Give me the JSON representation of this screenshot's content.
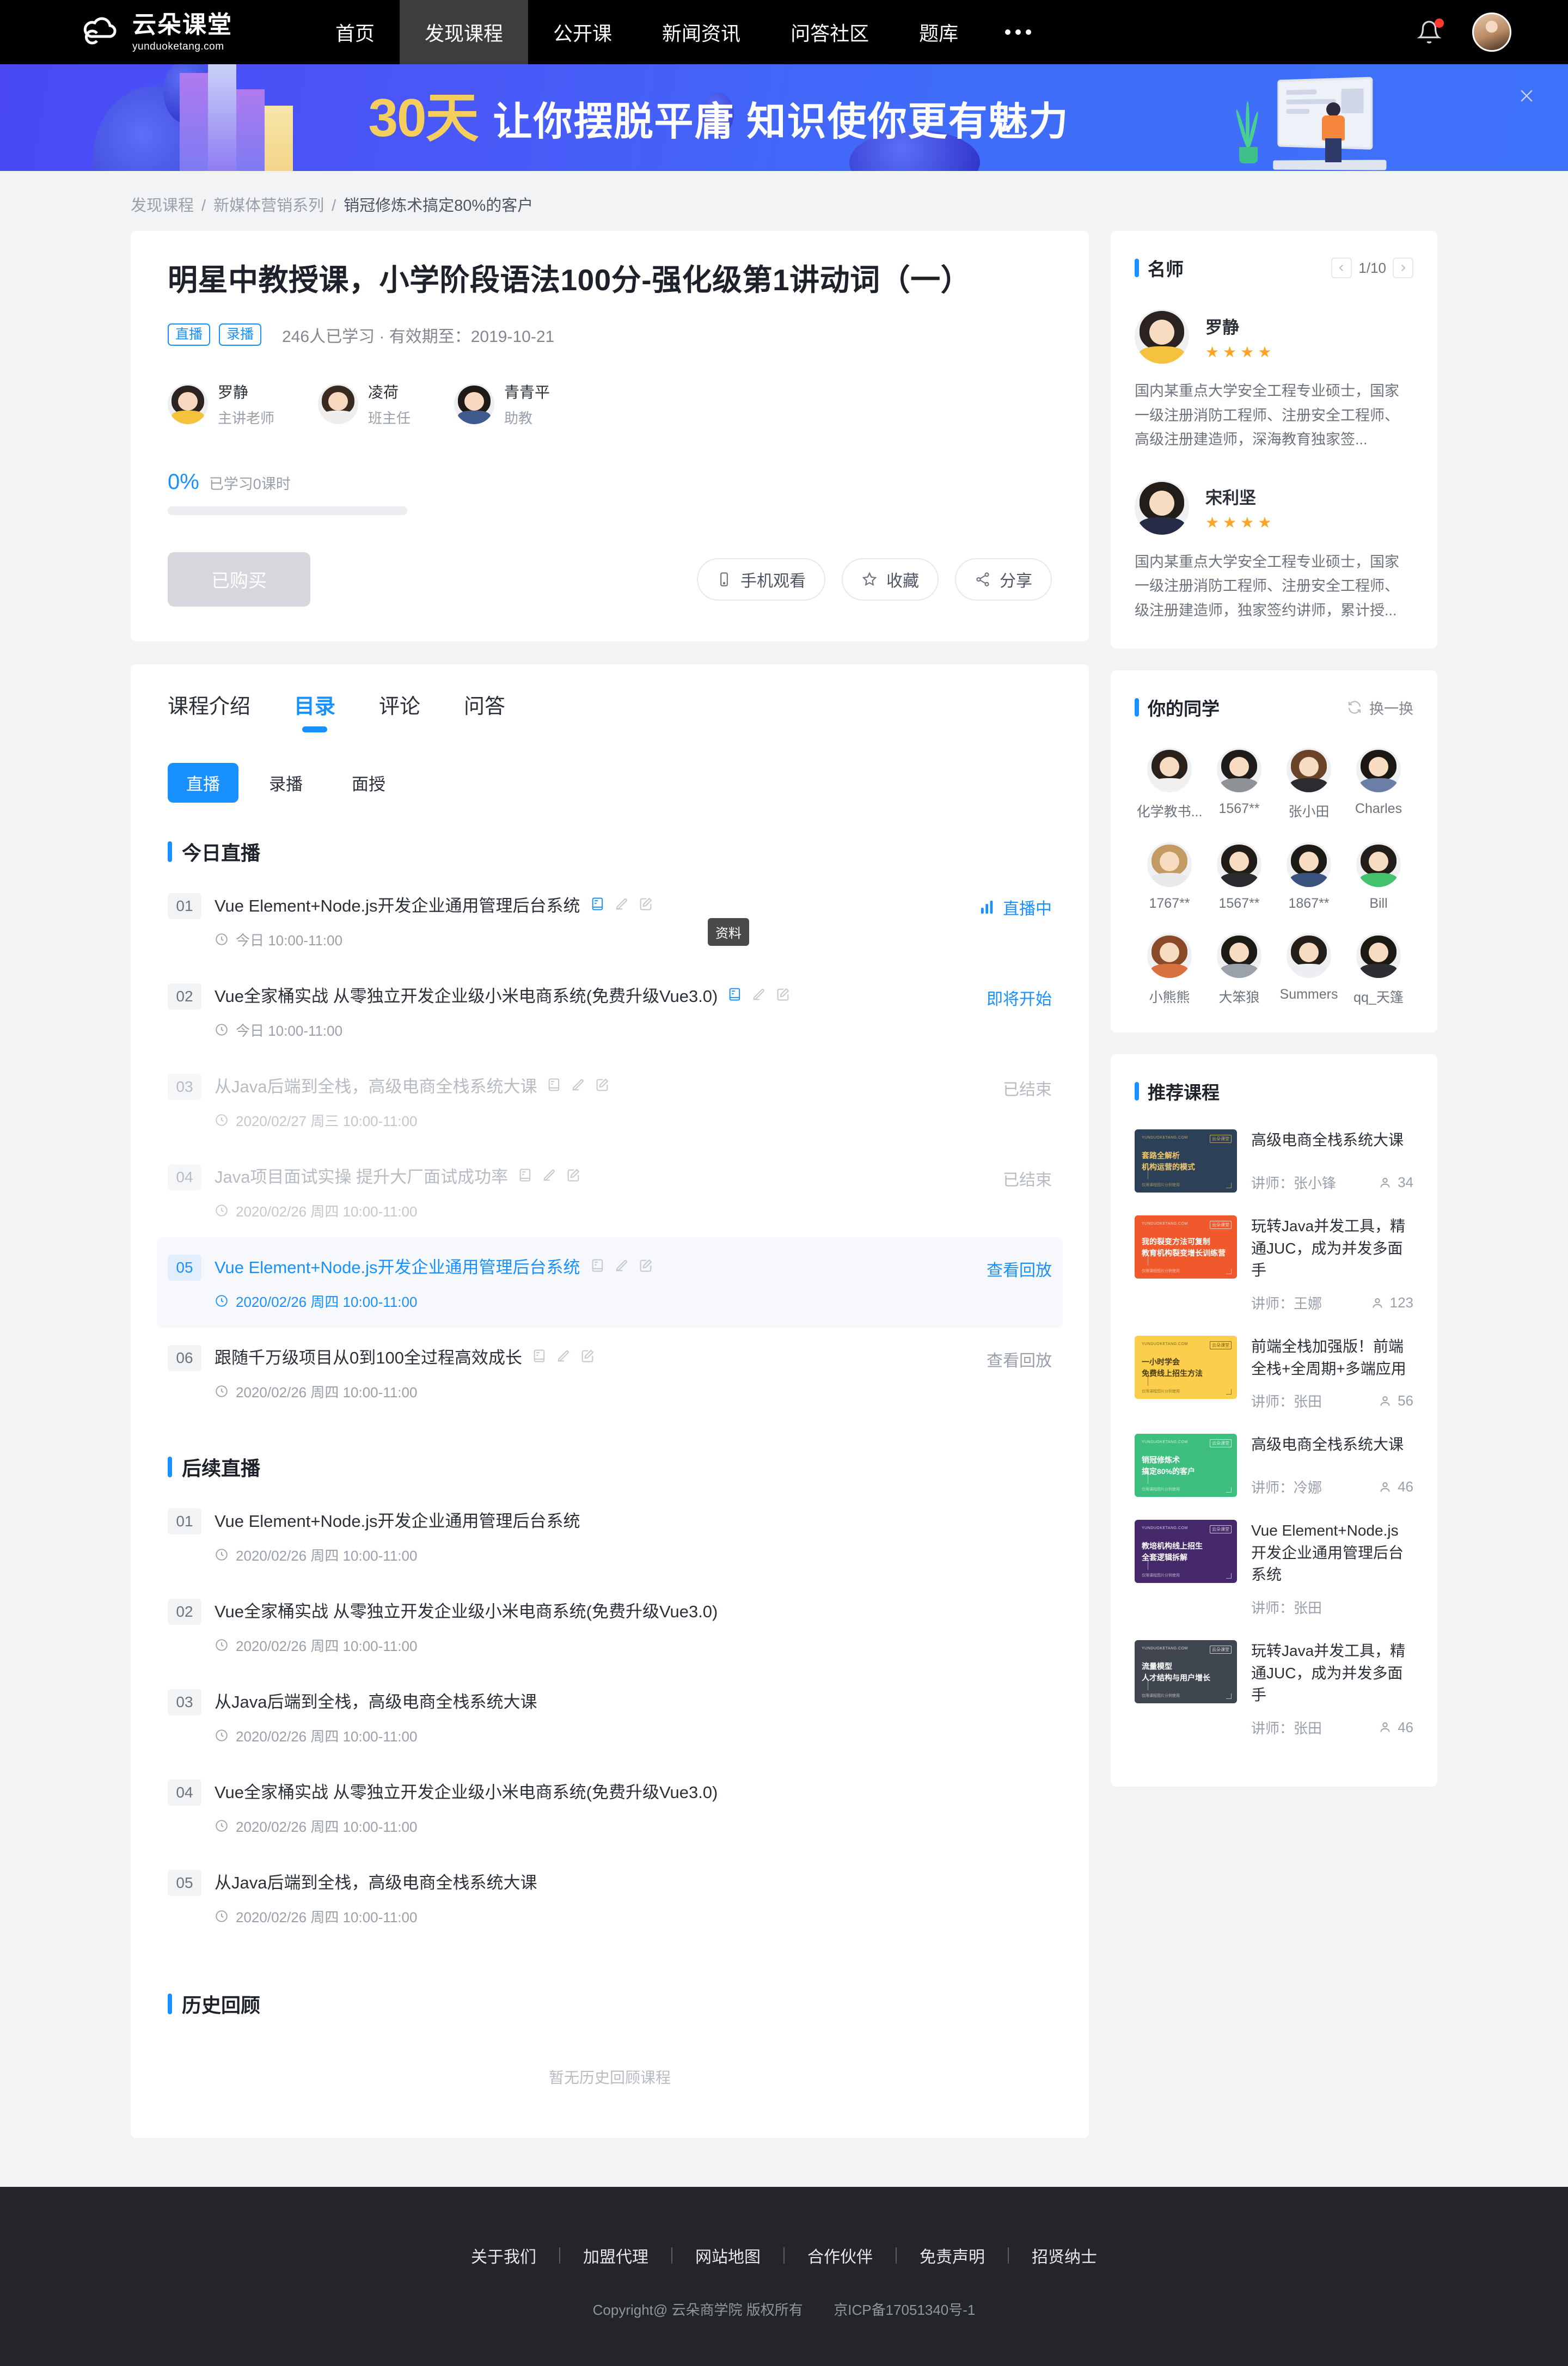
{
  "nav": {
    "logo_cn": "云朵课堂",
    "logo_en": "yunduoketang.com",
    "items": [
      {
        "label": "首页",
        "active": false
      },
      {
        "label": "发现课程",
        "active": true
      },
      {
        "label": "公开课",
        "active": false
      },
      {
        "label": "新闻资讯",
        "active": false
      },
      {
        "label": "问答社区",
        "active": false
      },
      {
        "label": "题库",
        "active": false
      }
    ],
    "more_icon": "more-dots-icon",
    "bell_icon": "bell-icon",
    "avatar_icon": "user-avatar"
  },
  "banner": {
    "highlight": "30天",
    "text": "让你摆脱平庸  知识使你更有魅力",
    "close_icon": "close-icon"
  },
  "breadcrumb": {
    "items": [
      "发现课程",
      "新媒体营销系列"
    ],
    "current": "销冠修炼术搞定80%的客户",
    "separator": "/"
  },
  "course": {
    "title": "明星中教授课，小学阶段语法100分-强化级第1讲动词（一）",
    "badges": [
      "直播",
      "录播"
    ],
    "meta": "246人已学习 · 有效期至：2019-10-21",
    "teachers": [
      {
        "name": "罗静",
        "role": "主讲老师"
      },
      {
        "name": "凌荷",
        "role": "班主任"
      },
      {
        "name": "青青平",
        "role": "助教"
      }
    ],
    "progress_percent": "0%",
    "progress_label": "已学习0课时",
    "progress_value": 0,
    "buy_button": "已购买",
    "mini_actions": [
      {
        "label": "手机观看",
        "icon": "phone-icon"
      },
      {
        "label": "收藏",
        "icon": "star-icon"
      },
      {
        "label": "分享",
        "icon": "share-icon"
      }
    ]
  },
  "tabs": [
    {
      "label": "课程介绍",
      "active": false
    },
    {
      "label": "目录",
      "active": true
    },
    {
      "label": "评论",
      "active": false
    },
    {
      "label": "问答",
      "active": false
    }
  ],
  "segments": [
    {
      "label": "直播",
      "active": true
    },
    {
      "label": "录播",
      "active": false
    },
    {
      "label": "面授",
      "active": false
    }
  ],
  "tooltip": "资料",
  "sections": [
    {
      "title": "今日直播",
      "lessons": [
        {
          "num": "01",
          "title": "Vue Element+Node.js开发企业通用管理后台系统",
          "time": "今日 10:00-11:00",
          "status": "直播中",
          "status_style": "blue",
          "row_style": "normal",
          "icons": true,
          "status_icon": "live-signal-icon"
        },
        {
          "num": "02",
          "title": "Vue全家桶实战 从零独立开发企业级小米电商系统(免费升级Vue3.0)",
          "time": "今日 10:00-11:00",
          "status": "即将开始",
          "status_style": "blue",
          "row_style": "normal",
          "icons": true,
          "status_icon": ""
        },
        {
          "num": "03",
          "title": "从Java后端到全栈，高级电商全栈系统大课",
          "time": "2020/02/27 周三 10:00-11:00",
          "status": "已结束",
          "status_style": "dim",
          "row_style": "dimmed",
          "icons": true,
          "status_icon": ""
        },
        {
          "num": "04",
          "title": "Java项目面试实操 提升大厂面试成功率",
          "time": "2020/02/26 周四 10:00-11:00",
          "status": "已结束",
          "status_style": "dim",
          "row_style": "dimmed",
          "icons": true,
          "status_icon": ""
        },
        {
          "num": "05",
          "title": "Vue Element+Node.js开发企业通用管理后台系统",
          "time": "2020/02/26 周四 10:00-11:00",
          "status": "查看回放",
          "status_style": "blue",
          "row_style": "highlight",
          "icons": true,
          "status_icon": ""
        },
        {
          "num": "06",
          "title": "跟随千万级项目从0到100全过程高效成长",
          "time": "2020/02/26 周四 10:00-11:00",
          "status": "查看回放",
          "status_style": "normal",
          "row_style": "normal",
          "icons": true,
          "status_icon": ""
        }
      ]
    },
    {
      "title": "后续直播",
      "lessons": [
        {
          "num": "01",
          "title": "Vue Element+Node.js开发企业通用管理后台系统",
          "time": "2020/02/26 周四 10:00-11:00",
          "status": "",
          "status_style": "normal",
          "row_style": "normal",
          "icons": false,
          "status_icon": ""
        },
        {
          "num": "02",
          "title": "Vue全家桶实战 从零独立开发企业级小米电商系统(免费升级Vue3.0)",
          "time": "2020/02/26 周四 10:00-11:00",
          "status": "",
          "status_style": "normal",
          "row_style": "normal",
          "icons": false,
          "status_icon": ""
        },
        {
          "num": "03",
          "title": "从Java后端到全栈，高级电商全栈系统大课",
          "time": "2020/02/26 周四 10:00-11:00",
          "status": "",
          "status_style": "normal",
          "row_style": "normal",
          "icons": false,
          "status_icon": ""
        },
        {
          "num": "04",
          "title": "Vue全家桶实战 从零独立开发企业级小米电商系统(免费升级Vue3.0)",
          "time": "2020/02/26 周四 10:00-11:00",
          "status": "",
          "status_style": "normal",
          "row_style": "normal",
          "icons": false,
          "status_icon": ""
        },
        {
          "num": "05",
          "title": "从Java后端到全栈，高级电商全栈系统大课",
          "time": "2020/02/26 周四 10:00-11:00",
          "status": "",
          "status_style": "normal",
          "row_style": "normal",
          "icons": false,
          "status_icon": ""
        }
      ]
    }
  ],
  "history": {
    "title": "历史回顾",
    "empty": "暂无历史回顾课程"
  },
  "sidebar": {
    "famous_teachers": {
      "title": "名师",
      "page": "1/10",
      "prev_icon": "chevron-left-icon",
      "next_icon": "chevron-right-icon",
      "list": [
        {
          "name": "罗静",
          "stars": 4,
          "desc": "国内某重点大学安全工程专业硕士，国家一级注册消防工程师、注册安全工程师、高级注册建造师，深海教育独家签...",
          "hair": "#2a2320",
          "body": "#f4c23c"
        },
        {
          "name": "宋利坚",
          "stars": 4,
          "desc": "国内某重点大学安全工程专业硕士，国家一级注册消防工程师、注册安全工程师、级注册建造师，独家签约讲师，累计授...",
          "hair": "#231d19",
          "body": "#262c46"
        }
      ]
    },
    "classmates": {
      "title": "你的同学",
      "refresh_label": "换一换",
      "refresh_icon": "refresh-icon",
      "list": [
        {
          "name": "化学教书...",
          "hair": "#2b211c",
          "body": "#f2f0ee"
        },
        {
          "name": "1567**",
          "hair": "#1f1b18",
          "body": "#8e9196"
        },
        {
          "name": "张小田",
          "hair": "#6b4327",
          "body": "#2c2c30"
        },
        {
          "name": "Charles",
          "hair": "#1c1713",
          "body": "#6b7fa6"
        },
        {
          "name": "1767**",
          "hair": "#c49a63",
          "body": "#e8e9eb"
        },
        {
          "name": "1567**",
          "hair": "#211c18",
          "body": "#2a2a2e"
        },
        {
          "name": "1867**",
          "hair": "#1d1915",
          "body": "#39527e"
        },
        {
          "name": "Bill",
          "hair": "#221d18",
          "body": "#43c16b"
        },
        {
          "name": "小熊熊",
          "hair": "#8a4a27",
          "body": "#d9713f"
        },
        {
          "name": "大笨狼",
          "hair": "#1e1a16",
          "body": "#9aa1ab"
        },
        {
          "name": "Summers",
          "hair": "#231e19",
          "body": "#eceef1"
        },
        {
          "name": "qq_天篷",
          "hair": "#1c1814",
          "body": "#2e2e32"
        }
      ]
    },
    "recommended": {
      "title": "推荐课程",
      "teacher_prefix": "讲师：",
      "list": [
        {
          "title": "高级电商全栈系统大课",
          "teacher": "张小锋",
          "count": "34",
          "thumb_bg": "#2c4058",
          "thumb_fg": "#f0c96a",
          "thumb_l1": "套路全解析",
          "thumb_l2": "机构运营的模式",
          "thumb_brand": "云朵课堂",
          "thumb_tiny": "YUNDUOKETANG.COM",
          "thumb_foot": "仅限课程图片分例使用"
        },
        {
          "title": "玩转Java并发工具，精通JUC，成为并发多面手",
          "teacher": "王娜",
          "count": "123",
          "thumb_bg": "#f0592c",
          "thumb_fg": "#ffffff",
          "thumb_l1": "我的裂变方法可复制",
          "thumb_l2": "教育机构裂变增长训练营",
          "thumb_brand": "云朵课堂",
          "thumb_tiny": "YUNDUOKETANG.COM",
          "thumb_foot": "仅限课程图片分例使用"
        },
        {
          "title": "前端全栈加强版！前端全栈+全周期+多端应用",
          "teacher": "张田",
          "count": "56",
          "thumb_bg": "#fbcf4b",
          "thumb_fg": "#4a3a10",
          "thumb_l1": "一小时学会",
          "thumb_l2": "免费线上招生方法",
          "thumb_brand": "云朵课堂",
          "thumb_tiny": "YUNDUOKETANG.COM",
          "thumb_foot": "仅限课程图片分例使用"
        },
        {
          "title": "高级电商全栈系统大课",
          "teacher": "冷娜",
          "count": "46",
          "thumb_bg": "#3fbf7f",
          "thumb_fg": "#ffffff",
          "thumb_l1": "销冠修炼术",
          "thumb_l2": "搞定80%的客户",
          "thumb_brand": "云朵课堂",
          "thumb_tiny": "YUNDUOKETANG.COM",
          "thumb_foot": "仅限课程图片分例使用"
        },
        {
          "title": "Vue Element+Node.js开发企业通用管理后台系统",
          "teacher": "张田",
          "count": "",
          "thumb_bg": "#46296b",
          "thumb_fg": "#ffffff",
          "thumb_l1": "教培机构线上招生",
          "thumb_l2": "全套逻辑拆解",
          "thumb_brand": "云朵课堂",
          "thumb_tiny": "YUNDUOKETANG.COM",
          "thumb_foot": "仅限课程图片分例使用"
        },
        {
          "title": "玩转Java并发工具，精通JUC，成为并发多面手",
          "teacher": "张田",
          "count": "46",
          "thumb_bg": "#40464f",
          "thumb_fg": "#ffffff",
          "thumb_l1": "流量模型",
          "thumb_l2": "人才结构与用户增长",
          "thumb_brand": "云朵课堂",
          "thumb_tiny": "YUNDUOKETANG.COM",
          "thumb_foot": "仅限课程图片分例使用"
        }
      ]
    }
  },
  "footer": {
    "links": [
      "关于我们",
      "加盟代理",
      "网站地图",
      "合作伙伴",
      "免责声明",
      "招贤纳士"
    ],
    "copyright_left": "Copyright@ 云朵商学院   版权所有",
    "copyright_right": "京ICP备17051340号-1"
  }
}
